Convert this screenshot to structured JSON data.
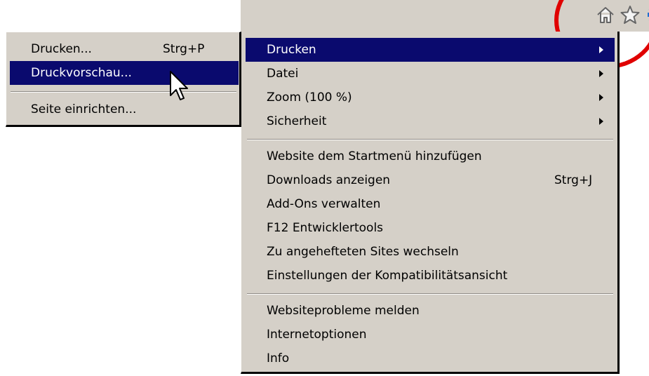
{
  "toolbar": {
    "icons": [
      "home-icon",
      "star-icon",
      "gear-icon"
    ],
    "accent_color": "#1f6fd1",
    "highlight_color": "#e00000"
  },
  "menu": {
    "items": [
      {
        "label": "Drucken",
        "submenu": true,
        "selected": true
      },
      {
        "label": "Datei",
        "submenu": true
      },
      {
        "label": "Zoom (100 %)",
        "submenu": true
      },
      {
        "label": "Sicherheit",
        "submenu": true
      },
      {
        "label": "Website dem Startmenü hinzufügen"
      },
      {
        "label": "Downloads anzeigen",
        "shortcut": "Strg+J"
      },
      {
        "label": "Add-Ons verwalten"
      },
      {
        "label": "F12 Entwicklertools"
      },
      {
        "label": "Zu angehefteten Sites wechseln"
      },
      {
        "label": "Einstellungen der Kompatibilitätsansicht"
      },
      {
        "label": "Websiteprobleme melden"
      },
      {
        "label": "Internetoptionen"
      },
      {
        "label": "Info"
      }
    ],
    "selection_color": "#0a0a6e"
  },
  "submenu": {
    "items": [
      {
        "label": "Drucken...",
        "shortcut": "Strg+P"
      },
      {
        "label": "Druckvorschau...",
        "selected": true
      },
      {
        "label": "Seite einrichten..."
      }
    ]
  }
}
